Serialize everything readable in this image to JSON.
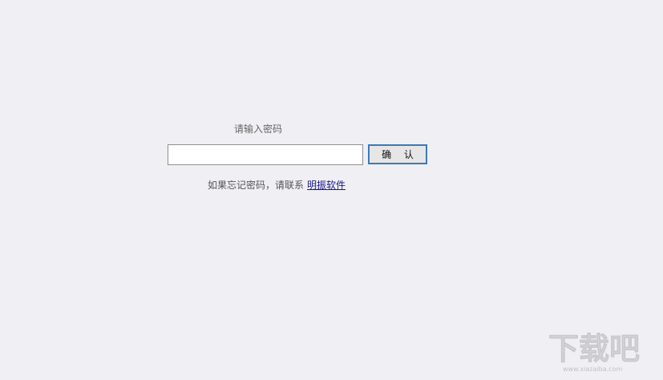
{
  "login": {
    "prompt": "请输入密码",
    "password_value": "",
    "confirm_label": "确 认",
    "forgot_text": "如果忘记密码，请联系",
    "contact_link": "明振软件"
  },
  "watermark": {
    "logo_text": "下载吧",
    "site": "www.xiazaiba.com"
  },
  "colors": {
    "background": "#f0eff3",
    "button_border": "#3a7ab8",
    "link": "#1a1a8c"
  },
  "icons": {
    "watermark": "site-logo-icon"
  }
}
